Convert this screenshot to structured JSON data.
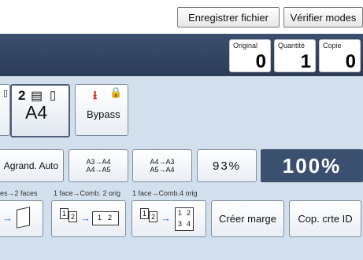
{
  "header": {
    "save_file_label": "Enregistrer fichier",
    "check_modes_label": "Vérifier modes"
  },
  "counters": [
    {
      "label": "Original",
      "value": "0"
    },
    {
      "label": "Quantité",
      "value": "1"
    },
    {
      "label": "Copie",
      "value": "0"
    }
  ],
  "paper": {
    "tray_number": "2",
    "tray_size": "A4",
    "bypass_label": "Bypass"
  },
  "zoom": {
    "auto_enlarge_label": "Agrand. Auto",
    "preset1_line1": "A3→A4",
    "preset1_line2": "A4→A5",
    "preset2_line1": "A4→A3",
    "preset2_line2": "A5→A4",
    "custom_pct": "93%",
    "current_pct": "100%"
  },
  "duplex": {
    "caption_1": "es→2 faces",
    "caption_2": "1 face→Comb. 2 orig",
    "caption_3": "1 face→Comb.4 orig",
    "page1": "1",
    "page2": "2",
    "page3": "3",
    "page4": "4",
    "margin_label": "Créer marge",
    "id_card_label": "Cop. crte ID"
  },
  "colors": {
    "status_bar": "#34465f",
    "panel": "#d2dfec",
    "accent_arrow": "#3b6fd9",
    "bypass_icon": "#d22a1f"
  }
}
